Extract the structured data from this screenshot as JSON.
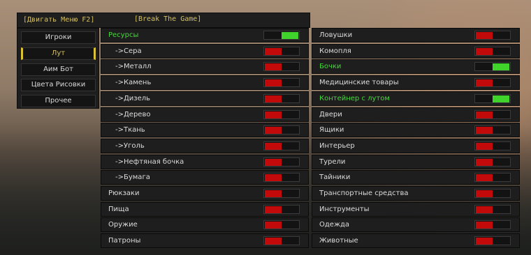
{
  "header": {
    "move_label": "[Двигать Меню F2]",
    "title": "[Break The Game]"
  },
  "sidebar": {
    "tabs": [
      {
        "label": "Игроки",
        "active": false
      },
      {
        "label": "Лут",
        "active": true
      },
      {
        "label": "Аим Бот",
        "active": false
      },
      {
        "label": "Цвета Рисовки",
        "active": false
      },
      {
        "label": "Прочее",
        "active": false
      }
    ]
  },
  "left_column": [
    {
      "label": "Ресурсы",
      "enabled": true
    },
    {
      "label": "->Сера",
      "enabled": false
    },
    {
      "label": "->Металл",
      "enabled": false
    },
    {
      "label": "->Камень",
      "enabled": false
    },
    {
      "label": "->Дизель",
      "enabled": false
    },
    {
      "label": "->Дерево",
      "enabled": false
    },
    {
      "label": "->Ткань",
      "enabled": false
    },
    {
      "label": "->Уголь",
      "enabled": false
    },
    {
      "label": "->Нефтяная бочка",
      "enabled": false
    },
    {
      "label": "->Бумага",
      "enabled": false
    },
    {
      "label": "Рюкзаки",
      "enabled": false
    },
    {
      "label": "Пища",
      "enabled": false
    },
    {
      "label": "Оружие",
      "enabled": false
    },
    {
      "label": "Патроны",
      "enabled": false
    }
  ],
  "right_column": [
    {
      "label": "Ловушки",
      "enabled": false
    },
    {
      "label": "Комопля",
      "enabled": false
    },
    {
      "label": "Бочки",
      "enabled": true
    },
    {
      "label": "Медицинские товары",
      "enabled": false
    },
    {
      "label": "Контейнер с лутом",
      "enabled": true
    },
    {
      "label": "Двери",
      "enabled": false
    },
    {
      "label": "Ящики",
      "enabled": false
    },
    {
      "label": "Интерьер",
      "enabled": false
    },
    {
      "label": "Турели",
      "enabled": false
    },
    {
      "label": "Тайники",
      "enabled": false
    },
    {
      "label": "Транспортные средства",
      "enabled": false
    },
    {
      "label": "Инструменты",
      "enabled": false
    },
    {
      "label": "Одежда",
      "enabled": false
    },
    {
      "label": "Животные",
      "enabled": false
    }
  ],
  "colors": {
    "accent": "#d6c060",
    "on": "#3fd32c",
    "off": "#c20a0a",
    "panel": "#1e1e1e"
  }
}
